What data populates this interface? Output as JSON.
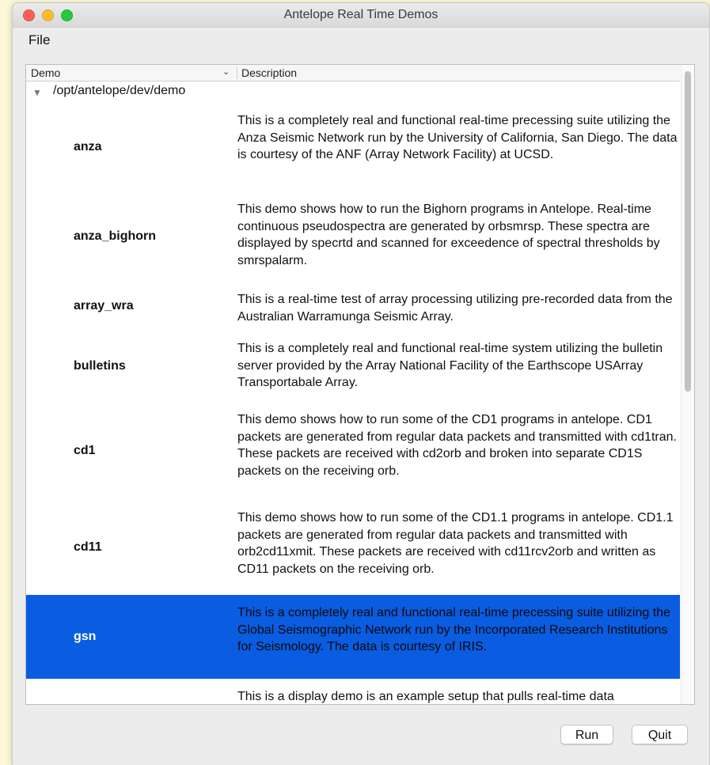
{
  "window": {
    "title": "Antelope Real Time Demos"
  },
  "menu": {
    "file": "File"
  },
  "tree": {
    "columns": {
      "demo": "Demo",
      "description": "Description"
    },
    "root": "/opt/antelope/dev/demo",
    "rows": [
      {
        "name": "anza",
        "description": "This is a completely real and functional real-time precessing suite utilizing the Anza Seismic Network run by the University of California, San Diego.  The data is courtesy of the ANF (Array Network Facility) at UCSD.",
        "selected": false
      },
      {
        "name": "anza_bighorn",
        "description": "This demo shows how to run the Bighorn programs in Antelope. Real-time continuous pseudospectra are generated by orbsmrsp. These spectra are displayed by specrtd and scanned for exceedence of spectral thresholds by smrspalarm.",
        "selected": false
      },
      {
        "name": "array_wra",
        "description": "This is a real-time test of array processing utilizing pre-recorded data from the Australian Warramunga Seismic Array.",
        "selected": false
      },
      {
        "name": "bulletins",
        "description": "This is a completely real and functional real-time system utilizing the bulletin server provided by the Array National Facility of the Earthscope USArray Transportabale Array.",
        "selected": false
      },
      {
        "name": "cd1",
        "description": "This demo shows how to run some of the CD1 programs in antelope. CD1 packets are generated from regular data packets and transmitted with cd1tran.  These packets are received with cd2orb and broken into separate CD1S packets on the receiving orb.",
        "selected": false
      },
      {
        "name": "cd11",
        "description": "This demo shows how to run some of the CD1.1 programs in antelope.  CD1.1 packets are generated from regular data packets and transmitted with orb2cd11xmit.  These packets are received with cd11rcv2orb and written as CD11 packets on the receiving orb.",
        "selected": false
      },
      {
        "name": "gsn",
        "description": "This is a completely real and functional real-time precessing suite utilizing the Global Seismographic Network run by the Incorporated Research Institutions for Seismology. The data is courtesy of IRIS.",
        "selected": true
      },
      {
        "name": "",
        "description": "This is a display demo is an example setup that pulls real-time data",
        "selected": false
      }
    ]
  },
  "buttons": {
    "run": "Run",
    "quit": "Quit"
  },
  "colors": {
    "selection": "#0a5ce0",
    "background": "#ececec"
  }
}
